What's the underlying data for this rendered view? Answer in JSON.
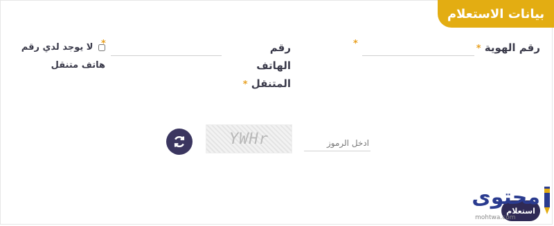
{
  "header": {
    "title": "بيانات الاستعلام"
  },
  "form": {
    "id_label": "رقم الهوية",
    "required_mark": "*",
    "id_value": "",
    "phone_label": "رقم الهاتف المتنقل",
    "phone_value": "",
    "no_phone_label": "لا يوجد لدي رقم هاتف متنقل",
    "captcha_text": "YWHr",
    "captcha_placeholder": "ادخل الرموز",
    "submit_label": "استعلام"
  },
  "watermark": {
    "brand": "محتوى",
    "domain": "mohtwa.com"
  },
  "icons": {
    "refresh": "refresh-icon",
    "pencil": "pencil-icon"
  },
  "colors": {
    "accent": "#e3ad12",
    "primary": "#3b3660",
    "required": "#e8a020"
  }
}
